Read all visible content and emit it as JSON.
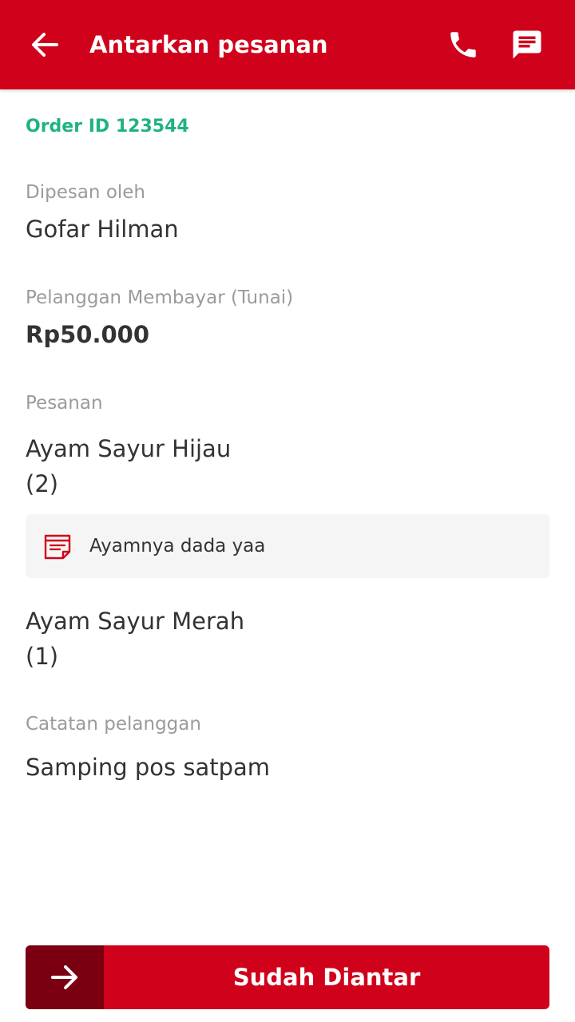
{
  "header": {
    "title": "Antarkan pesanan",
    "back_icon": "arrow-back-icon",
    "call_icon": "phone-icon",
    "chat_icon": "chat-icon",
    "background_color": "#d0021b"
  },
  "order": {
    "id_text": "Order ID 123544"
  },
  "customer": {
    "label": "Dipesan oleh",
    "name": "Gofar Hilman"
  },
  "payment": {
    "label": "Pelanggan Membayar (Tunai)",
    "amount": "Rp50.000"
  },
  "items_section": {
    "label": "Pesanan",
    "items": [
      {
        "name": "Ayam Sayur Hijau",
        "qty": "(2)",
        "note": "Ayamnya dada yaa",
        "note_icon": "note-icon"
      },
      {
        "name": "Ayam Sayur Merah",
        "qty": "(1)"
      }
    ]
  },
  "customer_note": {
    "label": "Catatan pelanggan",
    "text": "Samping pos satpam"
  },
  "action": {
    "label": "Sudah Diantar",
    "icon": "arrow-forward-icon"
  },
  "colors": {
    "primary": "#d0021b",
    "primary_dark": "#7a0011",
    "accent_green": "#1fb37e"
  }
}
